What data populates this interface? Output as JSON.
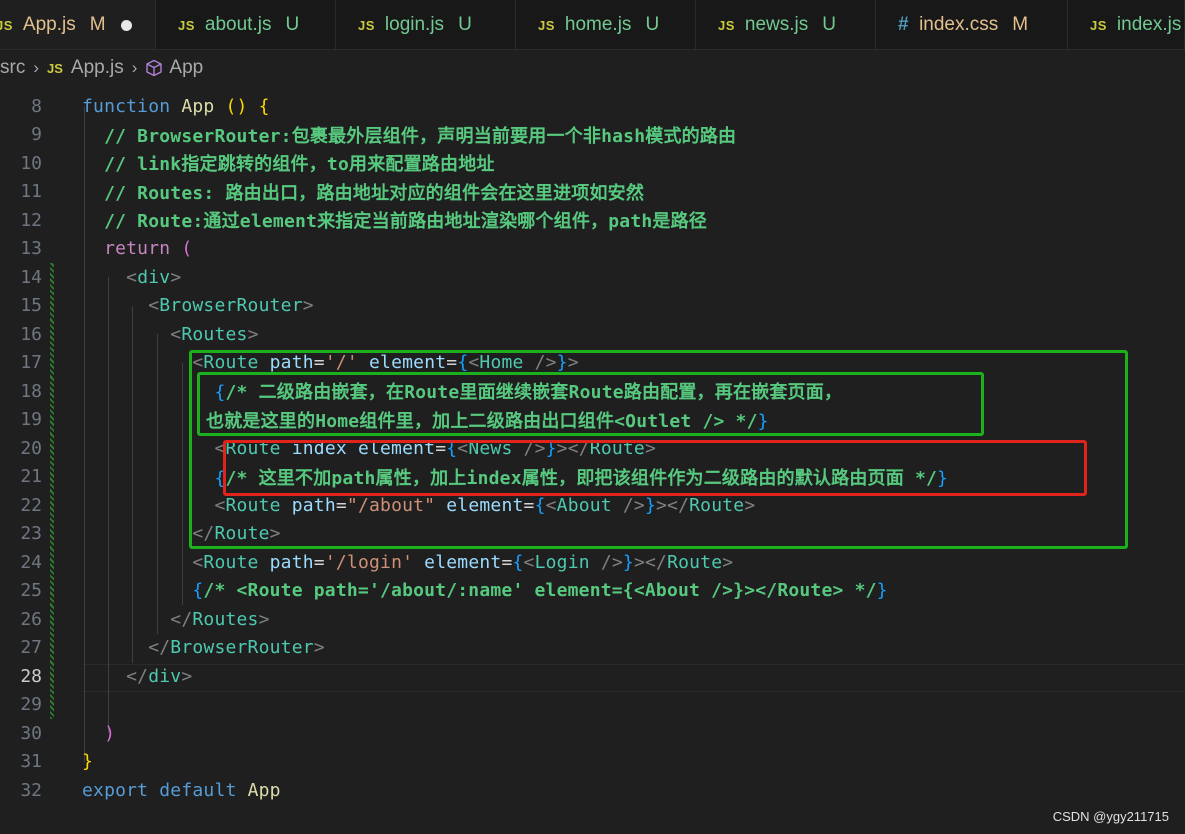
{
  "tabs": [
    {
      "icon": "JS",
      "name": "App.js",
      "status": "M",
      "modified": true,
      "active": true,
      "dirty": true
    },
    {
      "icon": "JS",
      "name": "about.js",
      "status": "U",
      "modified": false,
      "active": false
    },
    {
      "icon": "JS",
      "name": "login.js",
      "status": "U",
      "modified": false,
      "active": false
    },
    {
      "icon": "JS",
      "name": "home.js",
      "status": "U",
      "modified": false,
      "active": false
    },
    {
      "icon": "JS",
      "name": "news.js",
      "status": "U",
      "modified": false,
      "active": false
    },
    {
      "icon": "#",
      "name": "index.css",
      "status": "M",
      "modified": true,
      "active": false
    },
    {
      "icon": "JS",
      "name": "index.js",
      "status": "",
      "modified": false,
      "active": false
    }
  ],
  "breadcrumb": {
    "folder": "src",
    "file_icon": "JS",
    "file": "App.js",
    "symbol_icon": "cube-icon",
    "symbol": "App"
  },
  "editor": {
    "current_line": 28,
    "lines": [
      {
        "n": 8,
        "segs": [
          [
            "kw",
            "function "
          ],
          [
            "fn",
            "App "
          ],
          [
            "br",
            "() "
          ],
          [
            "br",
            "{"
          ]
        ]
      },
      {
        "n": 9,
        "segs": [
          [
            "cmb",
            "  // BrowserRouter:包裹最外层组件，声明当前要用一个非hash模式的路由"
          ]
        ]
      },
      {
        "n": 10,
        "segs": [
          [
            "cmb",
            "  // link指定跳转的组件，to用来配置路由地址"
          ]
        ]
      },
      {
        "n": 11,
        "segs": [
          [
            "cmb",
            "  // Routes: 路由出口，路由地址对应的组件会在这里进项如安然"
          ]
        ]
      },
      {
        "n": 12,
        "segs": [
          [
            "cmb",
            "  // Route:通过element来指定当前路由地址渲染哪个组件，path是路径"
          ]
        ]
      },
      {
        "n": 13,
        "segs": [
          [
            "rt",
            "  return "
          ],
          [
            "br2",
            "("
          ]
        ]
      },
      {
        "n": 14,
        "segs": [
          [
            "tg",
            "    <"
          ],
          [
            "tgn",
            "div"
          ],
          [
            "tg",
            ">"
          ]
        ]
      },
      {
        "n": 15,
        "segs": [
          [
            "tg",
            "      <"
          ],
          [
            "tgn",
            "BrowserRouter"
          ],
          [
            "tg",
            ">"
          ]
        ]
      },
      {
        "n": 16,
        "segs": [
          [
            "tg",
            "        <"
          ],
          [
            "tgn",
            "Routes"
          ],
          [
            "tg",
            ">"
          ]
        ]
      },
      {
        "n": 17,
        "segs": [
          [
            "tg",
            "          <"
          ],
          [
            "tgn",
            "Route "
          ],
          [
            "at",
            "path"
          ],
          [
            "pu",
            "="
          ],
          [
            "st",
            "'/'"
          ],
          [
            "at",
            " element"
          ],
          [
            "pu",
            "="
          ],
          [
            "br3",
            "{"
          ],
          [
            "tg",
            "<"
          ],
          [
            "tgn",
            "Home "
          ],
          [
            "tg",
            "/>"
          ],
          [
            "br3",
            "}"
          ],
          [
            "tg",
            ">"
          ]
        ]
      },
      {
        "n": 18,
        "segs": [
          [
            "br3",
            "            {"
          ],
          [
            "cmb",
            "/* 二级路由嵌套，在Route里面继续嵌套Route路由配置，再在嵌套页面，"
          ]
        ]
      },
      {
        "n": 19,
        "segs": [
          [
            "cmb",
            "也就是这里的Home组件里，加上二级路由出口组件<Outlet /> */"
          ],
          [
            "br3",
            "}"
          ]
        ]
      },
      {
        "n": 20,
        "segs": [
          [
            "tg",
            "            <"
          ],
          [
            "tgn",
            "Route "
          ],
          [
            "at",
            "index"
          ],
          [
            "at",
            " element"
          ],
          [
            "pu",
            "="
          ],
          [
            "br3",
            "{"
          ],
          [
            "tg",
            "<"
          ],
          [
            "tgn",
            "News "
          ],
          [
            "tg",
            "/>"
          ],
          [
            "br3",
            "}"
          ],
          [
            "tg",
            "></"
          ],
          [
            "tgn",
            "Route"
          ],
          [
            "tg",
            ">"
          ]
        ]
      },
      {
        "n": 21,
        "segs": [
          [
            "br3",
            "            {"
          ],
          [
            "cmb",
            "/* 这里不加path属性，加上index属性，即把该组件作为二级路由的默认路由页面 */"
          ],
          [
            "br3",
            "}"
          ]
        ]
      },
      {
        "n": 22,
        "segs": [
          [
            "tg",
            "            <"
          ],
          [
            "tgn",
            "Route "
          ],
          [
            "at",
            "path"
          ],
          [
            "pu",
            "="
          ],
          [
            "st",
            "\"/about\""
          ],
          [
            "at",
            " element"
          ],
          [
            "pu",
            "="
          ],
          [
            "br3",
            "{"
          ],
          [
            "tg",
            "<"
          ],
          [
            "tgn",
            "About "
          ],
          [
            "tg",
            "/>"
          ],
          [
            "br3",
            "}"
          ],
          [
            "tg",
            "></"
          ],
          [
            "tgn",
            "Route"
          ],
          [
            "tg",
            ">"
          ]
        ]
      },
      {
        "n": 23,
        "segs": [
          [
            "tg",
            "          </"
          ],
          [
            "tgn",
            "Route"
          ],
          [
            "tg",
            ">"
          ]
        ]
      },
      {
        "n": 24,
        "segs": [
          [
            "tg",
            "          <"
          ],
          [
            "tgn",
            "Route "
          ],
          [
            "at",
            "path"
          ],
          [
            "pu",
            "="
          ],
          [
            "st",
            "'/login'"
          ],
          [
            "at",
            " element"
          ],
          [
            "pu",
            "="
          ],
          [
            "br3",
            "{"
          ],
          [
            "tg",
            "<"
          ],
          [
            "tgn",
            "Login "
          ],
          [
            "tg",
            "/>"
          ],
          [
            "br3",
            "}"
          ],
          [
            "tg",
            "></"
          ],
          [
            "tgn",
            "Route"
          ],
          [
            "tg",
            ">"
          ]
        ]
      },
      {
        "n": 25,
        "segs": [
          [
            "br3",
            "          {"
          ],
          [
            "cmb",
            "/* <Route path='/about/:name' element={<About />}></Route> */"
          ],
          [
            "br3",
            "}"
          ]
        ]
      },
      {
        "n": 26,
        "segs": [
          [
            "tg",
            "        </"
          ],
          [
            "tgn",
            "Routes"
          ],
          [
            "tg",
            ">"
          ]
        ]
      },
      {
        "n": 27,
        "segs": [
          [
            "tg",
            "      </"
          ],
          [
            "tgn",
            "BrowserRouter"
          ],
          [
            "tg",
            ">"
          ]
        ]
      },
      {
        "n": 28,
        "segs": [
          [
            "tg",
            "    </"
          ],
          [
            "tgn",
            "div"
          ],
          [
            "tg",
            ">"
          ]
        ]
      },
      {
        "n": 29,
        "segs": []
      },
      {
        "n": 30,
        "segs": [
          [
            "br2",
            "  )"
          ]
        ]
      },
      {
        "n": 31,
        "segs": [
          [
            "br",
            "}"
          ]
        ]
      },
      {
        "n": 32,
        "segs": [
          [
            "kw",
            "export "
          ],
          [
            "kw",
            "default "
          ],
          [
            "fn",
            "App"
          ]
        ]
      }
    ]
  },
  "colors": {
    "green_box": "#1db01d",
    "red_box": "#e0241c",
    "background": "#1f1f1f"
  },
  "watermark": "CSDN @ygy211715"
}
